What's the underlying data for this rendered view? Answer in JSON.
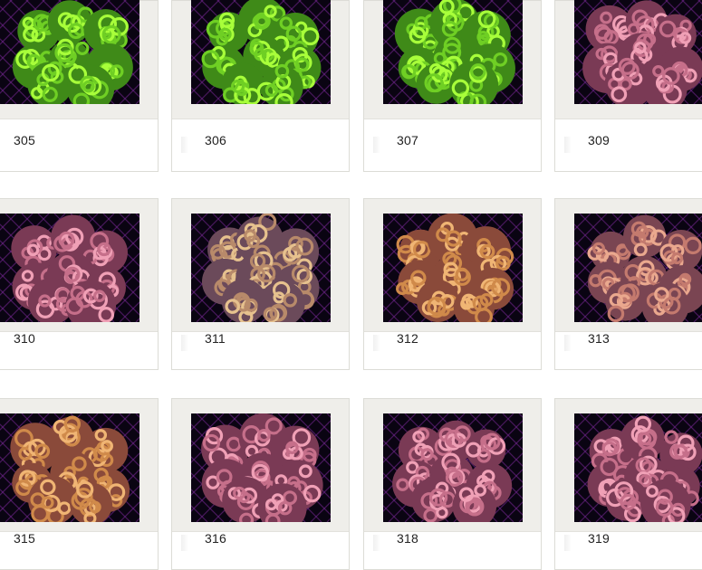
{
  "gallery": {
    "items": [
      {
        "id": "305",
        "color": "green"
      },
      {
        "id": "306",
        "color": "green"
      },
      {
        "id": "307",
        "color": "green"
      },
      {
        "id": "309",
        "color": "pink"
      },
      {
        "id": "310",
        "color": "pink"
      },
      {
        "id": "311",
        "color": "tan"
      },
      {
        "id": "312",
        "color": "orange"
      },
      {
        "id": "313",
        "color": "pinkorange"
      },
      {
        "id": "315",
        "color": "orange"
      },
      {
        "id": "316",
        "color": "pink"
      },
      {
        "id": "318",
        "color": "pink"
      },
      {
        "id": "319",
        "color": "pink"
      }
    ],
    "colors": {
      "green": {
        "base": "#6fcf24",
        "light": "#a8ff3a",
        "shade": "#3f8a18"
      },
      "pink": {
        "base": "#c66f8a",
        "light": "#f0a0b6",
        "shade": "#7a3a55"
      },
      "tan": {
        "base": "#b88a6a",
        "light": "#e6c18e",
        "shade": "#6b4a5a"
      },
      "orange": {
        "base": "#d08a4a",
        "light": "#f0b574",
        "shade": "#8a4a3a"
      },
      "pinkorange": {
        "base": "#c47a6e",
        "light": "#eaa88e",
        "shade": "#7a4552"
      }
    },
    "background": "#0a0412",
    "mesh_color": "#7b2a9a"
  }
}
